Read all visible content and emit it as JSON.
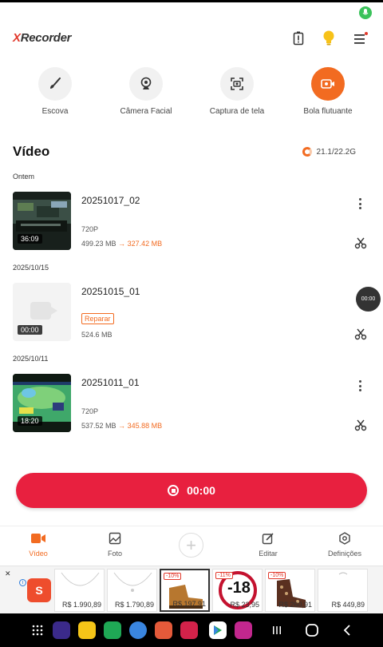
{
  "app": {
    "logo_prefix": "X",
    "logo_text": "Recorder"
  },
  "tools": [
    {
      "label": "Escova",
      "icon": "brush-icon"
    },
    {
      "label": "Câmera Facial",
      "icon": "webcam-icon"
    },
    {
      "label": "Captura de tela",
      "icon": "screenshot-icon"
    },
    {
      "label": "Bola flutuante",
      "icon": "floating-ball-icon"
    }
  ],
  "video_section": {
    "title": "Vídeo",
    "storage": "21.1/22.2G",
    "groups": [
      {
        "date": "Ontem",
        "items": [
          {
            "name": "20251017_02",
            "duration": "36:09",
            "resolution": "720P",
            "size": "499.23 MB",
            "arrow": "→",
            "compressed": "327.42 MB"
          }
        ]
      },
      {
        "date": "2025/10/15",
        "items": [
          {
            "name": "20251015_01",
            "duration": "00:00",
            "repair": "Reparar",
            "size": "524.6 MB"
          }
        ]
      },
      {
        "date": "2025/10/11",
        "items": [
          {
            "name": "20251011_01",
            "duration": "18:20",
            "resolution": "720P",
            "size": "537.52 MB",
            "arrow": "→",
            "compressed": "345.88 MB"
          }
        ]
      }
    ]
  },
  "floating_ball": {
    "time": "00:00"
  },
  "record_button": {
    "time": "00:00"
  },
  "bottom_nav": [
    {
      "label": "Vídeo",
      "active": true
    },
    {
      "label": "Foto"
    },
    {
      "label": "Editar"
    },
    {
      "label": "Definições"
    }
  ],
  "ad": {
    "close": "✕",
    "info": "i",
    "store_letter": "S",
    "products": [
      {
        "price": "R$ 1.990,89"
      },
      {
        "price": "R$ 1.790,89"
      },
      {
        "price": "R$ 197,91",
        "discount": "-10%"
      },
      {
        "price": "R$ 23,95",
        "discount": "-11%",
        "badge": "-18"
      },
      {
        "price": "R$ 260,91",
        "discount": "-10%"
      },
      {
        "price": "R$ 449,89"
      }
    ]
  },
  "colors": {
    "accent": "#f26b21",
    "record": "#e8203f"
  }
}
